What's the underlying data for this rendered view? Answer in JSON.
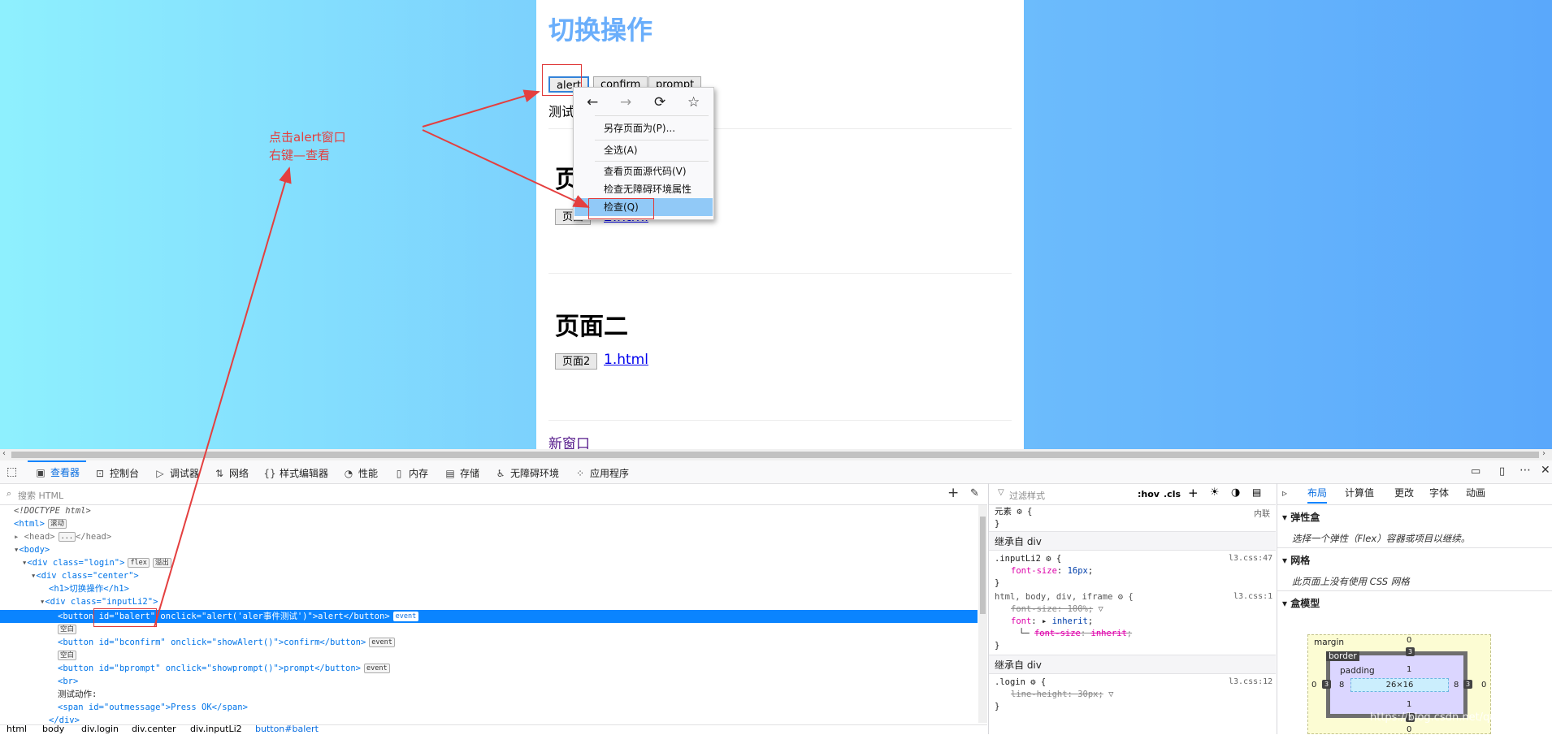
{
  "page": {
    "title": "切换操作",
    "buttons": {
      "alert": "alert",
      "confirm": "confirm",
      "prompt": "prompt"
    },
    "test_label": "测试",
    "section1": {
      "heading": "页",
      "button": "页面",
      "link": "2.html"
    },
    "section2": {
      "heading": "页面二",
      "button": "页面2",
      "link": "1.html"
    },
    "new_window_link": "新窗口"
  },
  "context_menu": {
    "nav": {
      "back": "←",
      "forward": "→",
      "reload": "⟳",
      "bookmark": "☆"
    },
    "items": [
      "另存页面为(P)...",
      "全选(A)",
      "查看页面源代码(V)",
      "检查无障碍环境属性",
      "检查(Q)"
    ]
  },
  "annotation": {
    "line1": "点击alert窗口",
    "line2": "右键—查看"
  },
  "devtools": {
    "tabs": [
      "查看器",
      "控制台",
      "调试器",
      "网络",
      "样式编辑器",
      "性能",
      "内存",
      "存储",
      "无障碍环境",
      "应用程序"
    ],
    "tab_icons": [
      "inspector-icon",
      "console-icon",
      "debugger-icon",
      "network-icon",
      "style-editor-icon",
      "performance-icon",
      "memory-icon",
      "storage-icon",
      "accessibility-icon",
      "application-icon"
    ],
    "search_placeholder": "搜索 HTML",
    "tree": [
      "<!DOCTYPE html>",
      "<html>",
      "<head>",
      "</head>",
      "<body>",
      "<div class=\"login\">",
      "<div class=\"center\">",
      "<h1>切换操作</h1>",
      "<div class=\"inputLi2\">",
      "<button id=\"balert\" onclick=\"alert('aler事件测试')\">alert</button>",
      "空白",
      "<button id=\"bconfirm\" onclick=\"showAlert()\">confirm</button>",
      "空白",
      "<button id=\"bprompt\" onclick=\"showprompt()\">prompt</button>",
      "<br>",
      "测试动作:",
      "<span id=\"outmessage\">Press OK</span>",
      "</div>"
    ],
    "badges": {
      "scroll": "滚动",
      "flex": "flex",
      "overflow": "溢出",
      "event": "event",
      "ellipsis": "..."
    },
    "breadcrumb": [
      "html",
      "body",
      "div.login",
      "div.center",
      "div.inputLi2",
      "button#balert"
    ],
    "rules": {
      "filter_placeholder": "过滤样式",
      "hov": ":hov",
      "cls": ".cls",
      "element_label": "元素",
      "inline_label": "内联",
      "inherited1": "继承自 div",
      "inherited2": "继承自 div",
      "r1_selector": ".inputLi2",
      "r1_source": "l3.css:47",
      "r1_prop": "font-size",
      "r1_val": "16px",
      "r2_selector": "html, body, div, iframe",
      "r2_source": "l3.css:1",
      "r2_prop1": "font-size",
      "r2_val1": "100%",
      "r2_prop2": "font",
      "r2_val2": "inherit",
      "r2_prop3": "font-size",
      "r2_val3": "inherit",
      "r3_selector": ".login",
      "r3_source": "l3.css:12",
      "r3_prop": "line-height",
      "r3_val": "30px"
    },
    "layout": {
      "tabs": [
        "布局",
        "计算值",
        "更改",
        "字体",
        "动画"
      ],
      "flex_title": "弹性盒",
      "flex_note": "选择一个弹性（Flex）容器或项目以继续。",
      "grid_title": "网格",
      "grid_note": "此页面上没有使用 CSS 网格",
      "boxmodel_title": "盒模型",
      "margin_label": "margin",
      "border_label": "border",
      "padding_label": "padding",
      "margin": {
        "top": "0",
        "right": "0",
        "bottom": "0",
        "left": "0"
      },
      "border": {
        "top": "3",
        "right": "3",
        "bottom": "3",
        "left": "3"
      },
      "padding": {
        "top": "1",
        "right": "8",
        "bottom": "1",
        "left": "8"
      },
      "content": "26×16"
    }
  },
  "watermark": "https://blog.csdn.net/qq_42...c21"
}
